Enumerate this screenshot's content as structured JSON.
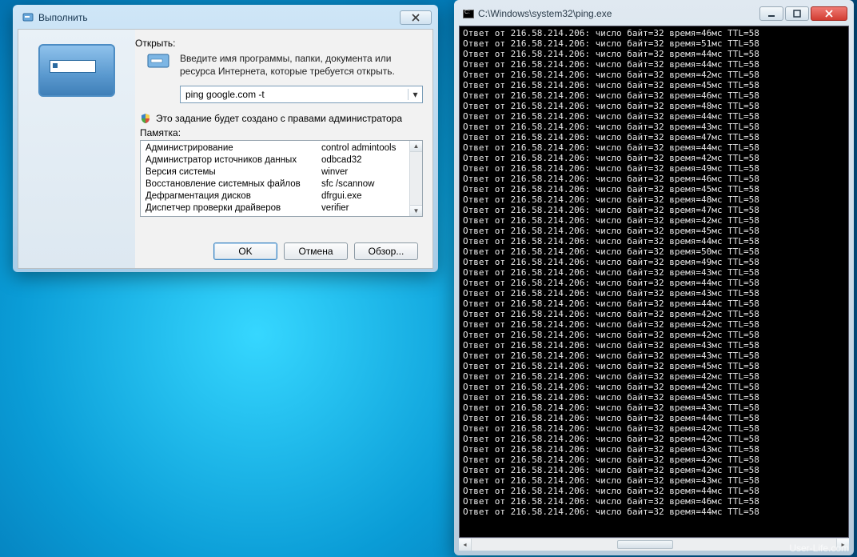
{
  "watermark": "User-Life.com",
  "run": {
    "title": "Выполнить",
    "open_label": "Открыть:",
    "hint": "Введите имя программы, папки, документа или ресурса Интернета, которые требуется открыть.",
    "input_value": "ping google.com -t",
    "admin_note": "Это задание будет создано с правами администратора",
    "pametka_label": "Памятка:",
    "pametka": [
      {
        "name": "Администрирование",
        "cmd": "control admintools"
      },
      {
        "name": "Администратор источников данных",
        "cmd": "odbcad32"
      },
      {
        "name": "Версия системы",
        "cmd": "winver"
      },
      {
        "name": "Восстановление системных файлов",
        "cmd": "sfc /scannow"
      },
      {
        "name": "Дефрагментация дисков",
        "cmd": "dfrgui.exe"
      },
      {
        "name": "Диспетчер проверки драйверов",
        "cmd": "verifier"
      }
    ],
    "buttons": {
      "ok": "OK",
      "cancel": "Отмена",
      "browse": "Обзор..."
    }
  },
  "cmd": {
    "title": "C:\\Windows\\system32\\ping.exe",
    "ip": "216.58.214.206",
    "bytes": 32,
    "ttl": 58,
    "times_ms": [
      46,
      51,
      44,
      44,
      42,
      45,
      46,
      48,
      44,
      43,
      47,
      44,
      42,
      49,
      46,
      45,
      48,
      47,
      42,
      45,
      44,
      50,
      49,
      43,
      44,
      43,
      44,
      42,
      42,
      42,
      43,
      43,
      45,
      42,
      42,
      45,
      43,
      44,
      42,
      42,
      43,
      42,
      42,
      43,
      44,
      46,
      44
    ]
  }
}
